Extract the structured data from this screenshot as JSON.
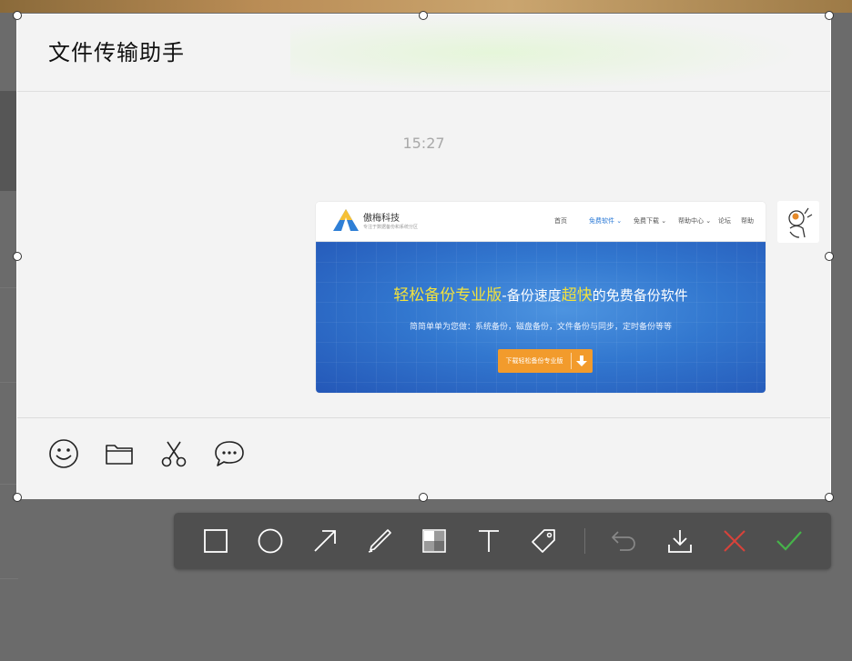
{
  "chat": {
    "title": "文件传输助手",
    "timestamp": "15:27"
  },
  "shared_image": {
    "brand_name": "傲梅科技",
    "brand_tagline": "专注于数据备份和系统分区",
    "nav_items": [
      "首页",
      "免费软件",
      "免费下载",
      "帮助中心",
      "论坛",
      "帮助"
    ],
    "active_nav": "免费软件",
    "headline_highlight": "轻松备份专业版",
    "headline_middle": "-备份速度",
    "headline_highlight2": "超快",
    "headline_end": "的免费备份软件",
    "subheadline": "简简单单为您做：系统备份，磁盘备份，文件备份与同步，定时备份等等",
    "download_button": "下载轻松备份专业版"
  },
  "input_toolbar": {
    "icons": [
      "emoji-icon",
      "folder-icon",
      "scissors-icon",
      "chat-bubble-icon"
    ]
  },
  "screenshot_toolbar": {
    "tools": [
      "rectangle",
      "ellipse",
      "arrow",
      "pen",
      "mosaic",
      "text",
      "tag",
      "undo",
      "save",
      "cancel",
      "confirm"
    ],
    "colors": {
      "cancel": "#d8423a",
      "confirm": "#46b34a",
      "icon": "#ffffff",
      "disabled": "#888888"
    }
  }
}
